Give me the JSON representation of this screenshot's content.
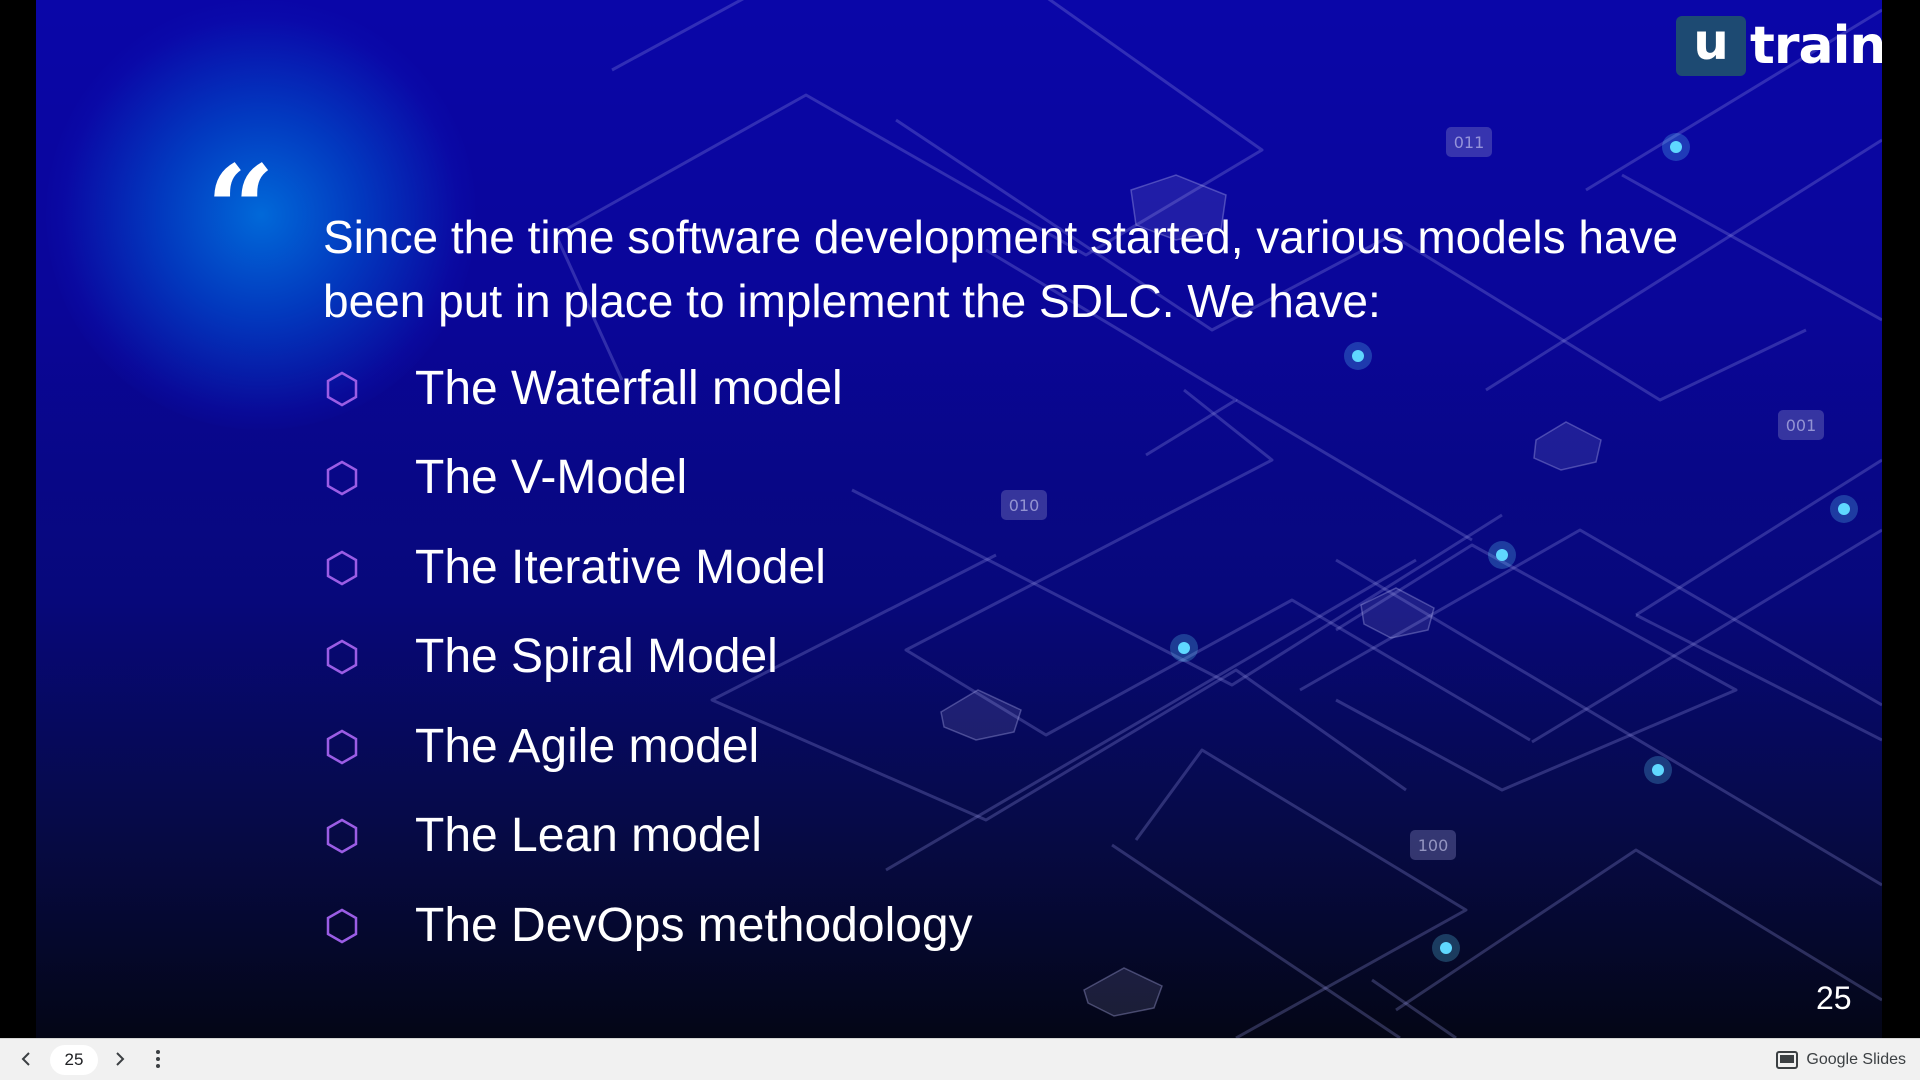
{
  "slide": {
    "logo": {
      "badge_text": "u",
      "word": "train"
    },
    "quote_icon": "opening-quote-mark",
    "intro": "Since the time software development started, various models have been put in place to implement the SDLC. We have:",
    "models": [
      "The Waterfall model",
      "The V-Model",
      "The Iterative Model",
      "The Spiral Model",
      "The Agile model",
      "The Lean model",
      "The DevOps methodology"
    ],
    "bullet_icon": "hexagon-outline",
    "bullet_color": "#9b5de5",
    "binary_tags": [
      "011",
      "010",
      "001",
      "100"
    ],
    "slide_number": "25"
  },
  "toolbar": {
    "prev_icon": "chevron-left-icon",
    "page_value": "25",
    "next_icon": "chevron-right-icon",
    "menu_icon": "more-vertical-icon",
    "brand_icon": "slides-icon",
    "brand_label": "Google Slides"
  },
  "colors": {
    "background_top": "#0a06a8",
    "background_bottom": "#040616",
    "text": "#ffffff",
    "logo_badge": "#1d4a72",
    "toolbar_bg": "#f1f1f1"
  }
}
